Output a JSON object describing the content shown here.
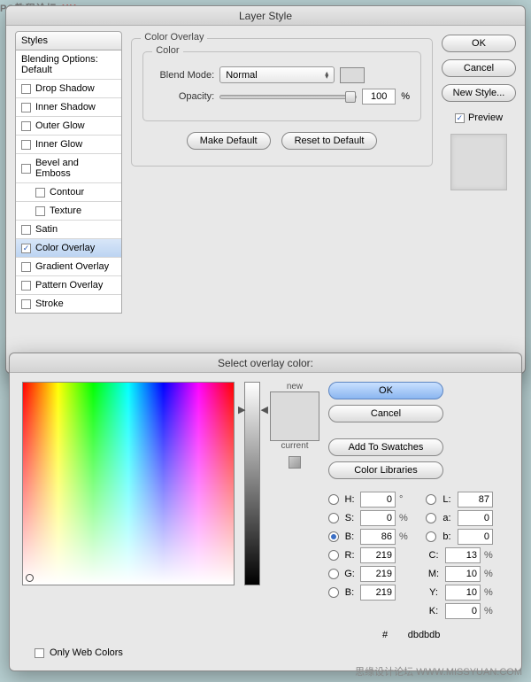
{
  "watermark": {
    "left": "PS教程论坛",
    "bottom": "思缘设计论坛  WWW.MISSYUAN.COM"
  },
  "layer_style": {
    "title": "Layer Style",
    "styles_header": "Styles",
    "blending_default": "Blending Options: Default",
    "items": [
      {
        "label": "Drop Shadow",
        "checked": false
      },
      {
        "label": "Inner Shadow",
        "checked": false
      },
      {
        "label": "Outer Glow",
        "checked": false
      },
      {
        "label": "Inner Glow",
        "checked": false
      },
      {
        "label": "Bevel and Emboss",
        "checked": false
      },
      {
        "label": "Contour",
        "checked": false,
        "sub": true
      },
      {
        "label": "Texture",
        "checked": false,
        "sub": true
      },
      {
        "label": "Satin",
        "checked": false
      },
      {
        "label": "Color Overlay",
        "checked": true,
        "selected": true
      },
      {
        "label": "Gradient Overlay",
        "checked": false
      },
      {
        "label": "Pattern Overlay",
        "checked": false
      },
      {
        "label": "Stroke",
        "checked": false
      }
    ],
    "group_label": "Color Overlay",
    "inner_group_label": "Color",
    "blend_mode_label": "Blend Mode:",
    "blend_mode_value": "Normal",
    "opacity_label": "Opacity:",
    "opacity_value": "100",
    "opacity_unit": "%",
    "make_default": "Make Default",
    "reset_default": "Reset to Default",
    "buttons": {
      "ok": "OK",
      "cancel": "Cancel",
      "new_style": "New Style..."
    },
    "preview_label": "Preview"
  },
  "color_picker": {
    "title": "Select overlay color:",
    "new_label": "new",
    "current_label": "current",
    "buttons": {
      "ok": "OK",
      "cancel": "Cancel",
      "swatches": "Add To Swatches",
      "libraries": "Color Libraries"
    },
    "only_web": "Only Web Colors",
    "hsb": {
      "h": "0",
      "s": "0",
      "b": "86"
    },
    "lab": {
      "l": "87",
      "a": "0",
      "b": "0"
    },
    "rgb": {
      "r": "219",
      "g": "219",
      "b": "219"
    },
    "cmyk": {
      "c": "13",
      "m": "10",
      "y": "10",
      "k": "0"
    },
    "hex": "dbdbdb",
    "deg": "°",
    "pct": "%",
    "hash": "#"
  }
}
